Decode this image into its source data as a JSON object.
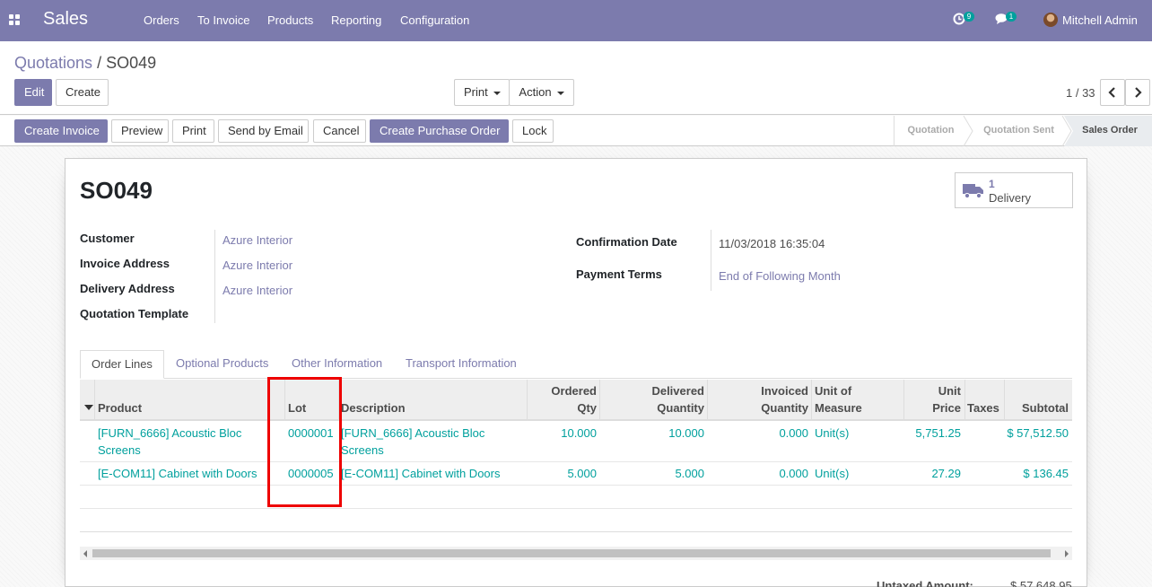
{
  "app": {
    "name": "Sales"
  },
  "nav": {
    "menus": [
      "Orders",
      "To Invoice",
      "Products",
      "Reporting",
      "Configuration"
    ],
    "activity_badge": "9",
    "messages_badge": "1",
    "user": "Mitchell Admin"
  },
  "breadcrumb": {
    "parent": "Quotations",
    "separator": "/",
    "current": "SO049"
  },
  "control": {
    "edit": "Edit",
    "create": "Create",
    "print": "Print",
    "action": "Action",
    "pager": "1 / 33"
  },
  "statusbar": {
    "buttons": [
      "Create Invoice",
      "Preview",
      "Print",
      "Send by Email",
      "Cancel",
      "Create Purchase Order",
      "Lock"
    ],
    "stages": [
      "Quotation",
      "Quotation Sent",
      "Sales Order"
    ],
    "active_stage": "Sales Order"
  },
  "form": {
    "title": "SO049",
    "delivery": {
      "count": "1",
      "label": "Delivery"
    },
    "left_fields": [
      {
        "label": "Customer",
        "value": "Azure Interior"
      },
      {
        "label": "Invoice Address",
        "value": "Azure Interior"
      },
      {
        "label": "Delivery Address",
        "value": "Azure Interior"
      },
      {
        "label": "Quotation Template",
        "value": ""
      }
    ],
    "right_fields": [
      {
        "label": "Confirmation Date",
        "value": "11/03/2018 16:35:04"
      },
      {
        "label": "Payment Terms",
        "value": "End of Following Month"
      }
    ]
  },
  "tabs": [
    "Order Lines",
    "Optional Products",
    "Other Information",
    "Transport Information"
  ],
  "table": {
    "headers": {
      "product": "Product",
      "lot": "Lot",
      "description": "Description",
      "ordered_qty": [
        "Ordered",
        "Qty"
      ],
      "delivered_qty": [
        "Delivered",
        "Quantity"
      ],
      "invoiced_qty": [
        "Invoiced",
        "Quantity"
      ],
      "uom": [
        "Unit of",
        "Measure"
      ],
      "unit_price": [
        "Unit",
        "Price"
      ],
      "taxes": "Taxes",
      "subtotal": "Subtotal"
    },
    "rows": [
      {
        "product": [
          "[FURN_6666] Acoustic Bloc",
          "Screens"
        ],
        "lot": "0000001",
        "description": [
          "[FURN_6666] Acoustic Bloc",
          "Screens"
        ],
        "ordered_qty": "10.000",
        "delivered_qty": "10.000",
        "invoiced_qty": "0.000",
        "uom": "Unit(s)",
        "unit_price": "5,751.25",
        "taxes": "",
        "subtotal": "$ 57,512.50"
      },
      {
        "product": [
          "[E-COM11] Cabinet with Doors"
        ],
        "lot": "0000005",
        "description": [
          "[E-COM11] Cabinet with Doors"
        ],
        "ordered_qty": "5.000",
        "delivered_qty": "5.000",
        "invoiced_qty": "0.000",
        "uom": "Unit(s)",
        "unit_price": "27.29",
        "taxes": "",
        "subtotal": "$ 136.45"
      }
    ]
  },
  "totals": {
    "untaxed_label": "Untaxed Amount:",
    "untaxed_value": "$ 57,648.95"
  },
  "colors": {
    "brand": "#7c7bad",
    "link": "#00a09d",
    "highlight": "#e00000"
  }
}
